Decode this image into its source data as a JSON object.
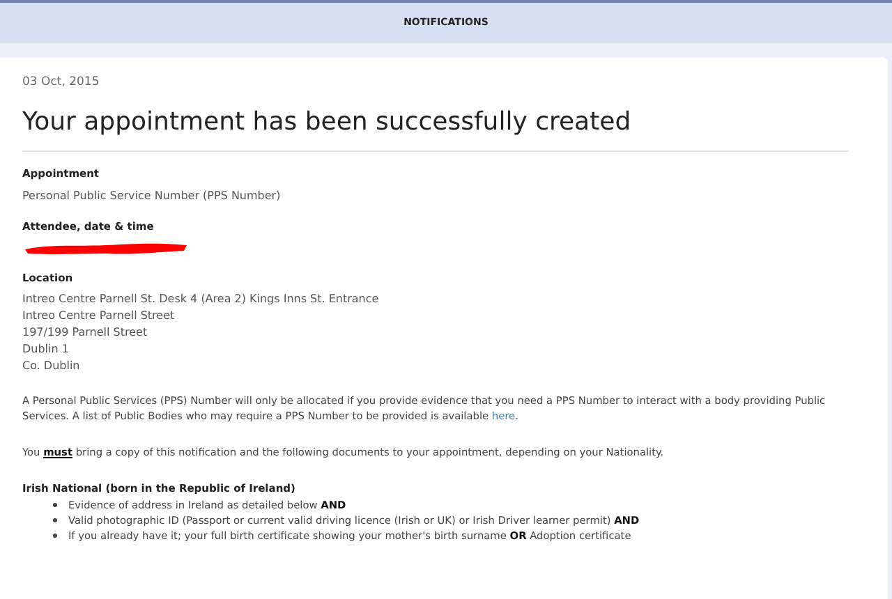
{
  "header": {
    "title": "NOTIFICATIONS"
  },
  "notification": {
    "date": "03 Oct, 2015",
    "title": "Your appointment has been successfully created",
    "sections": [
      {
        "heading": "Appointment",
        "lines": [
          "Personal Public Service Number (PPS Number)"
        ],
        "redacted": false
      },
      {
        "heading": "Attendee, date & time",
        "redacted": true
      },
      {
        "heading": "Location",
        "lines": [
          "Intreo Centre Parnell St. Desk 4 (Area 2) Kings Inns St. Entrance",
          "Intreo Centre Parnell Street",
          "197/199 Parnell Street",
          "Dublin 1",
          "Co. Dublin"
        ],
        "redacted": false
      }
    ],
    "info": {
      "text": "A Personal Public Services (PPS) Number will only be allocated if you provide evidence that you need a PPS Number to interact with a body providing Public Services. A list of Public Bodies who may require a PPS Number to be provided is available",
      "link": "here",
      "after": "."
    },
    "notice": "You **must** bring a copy of this notification and the following documents to your appointment, depending on your Nationality.",
    "requirements": {
      "heading": "Irish National (born in the Republic of Ireland)",
      "items": [
        "Evidence of address in Ireland as detailed below **AND**",
        "Valid photographic ID (Passport or current valid driving licence (Irish or UK) or Irish Driver learner permit) **AND**",
        "If you already have it; your full birth certificate showing your mother's birth surname **OR** Adoption certificate"
      ]
    }
  }
}
